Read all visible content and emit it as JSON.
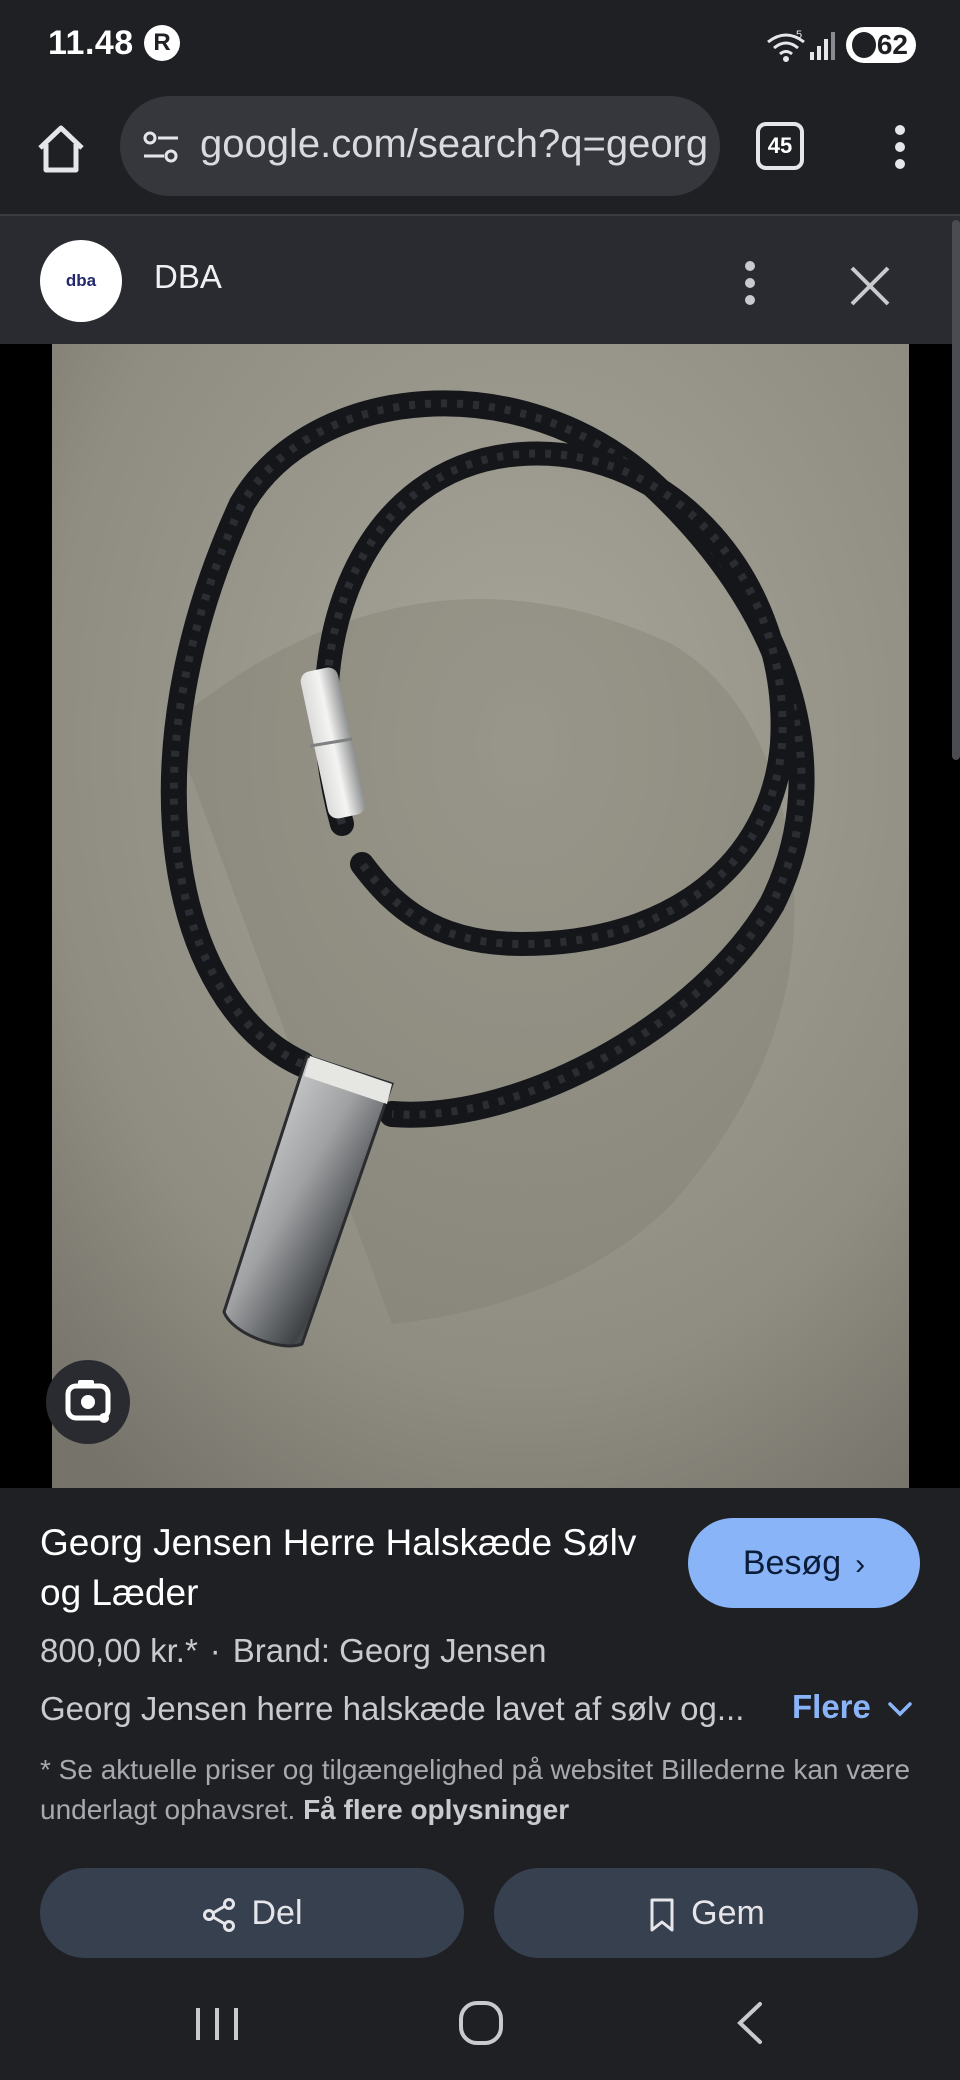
{
  "status_bar": {
    "time": "11.48",
    "app_icon": "R",
    "network_label": "5",
    "battery": "62",
    "icons": [
      "r-app-icon",
      "wifi-icon",
      "signal-icon",
      "battery-icon"
    ]
  },
  "browser": {
    "url": "google.com/search?q=georg",
    "tab_count": "45",
    "icons": [
      "home-icon",
      "site-settings-icon",
      "tabs-icon",
      "more-vert-icon"
    ]
  },
  "site": {
    "logo_text": "dba",
    "name": "DBA",
    "icons": [
      "more-vert-icon",
      "close-icon"
    ]
  },
  "image": {
    "alt_subject": "braided leather necklace with silver pendant",
    "lens_icon": "google-lens-icon"
  },
  "result": {
    "title": "Georg Jensen Herre Halskæde Sølv og Læder",
    "visit_label": "Besøg",
    "price": "800,00 kr.*",
    "separator": "·",
    "brand": "Brand: Georg Jensen",
    "description": "Georg Jensen herre halskæde lavet af sølv og...",
    "more_label": "Flere",
    "disclaimer": "* Se aktuelle priser og tilgængelighed på websitet Billederne kan være underlagt ophavsret.",
    "disclaimer_link": "Få flere oplysninger",
    "share_label": "Del",
    "save_label": "Gem"
  },
  "colors": {
    "background": "#1f2024",
    "accent": "#8ab4f8",
    "button": "#37404f"
  },
  "nav": {
    "icons": [
      "recents-icon",
      "home-circle-icon",
      "back-icon"
    ]
  }
}
